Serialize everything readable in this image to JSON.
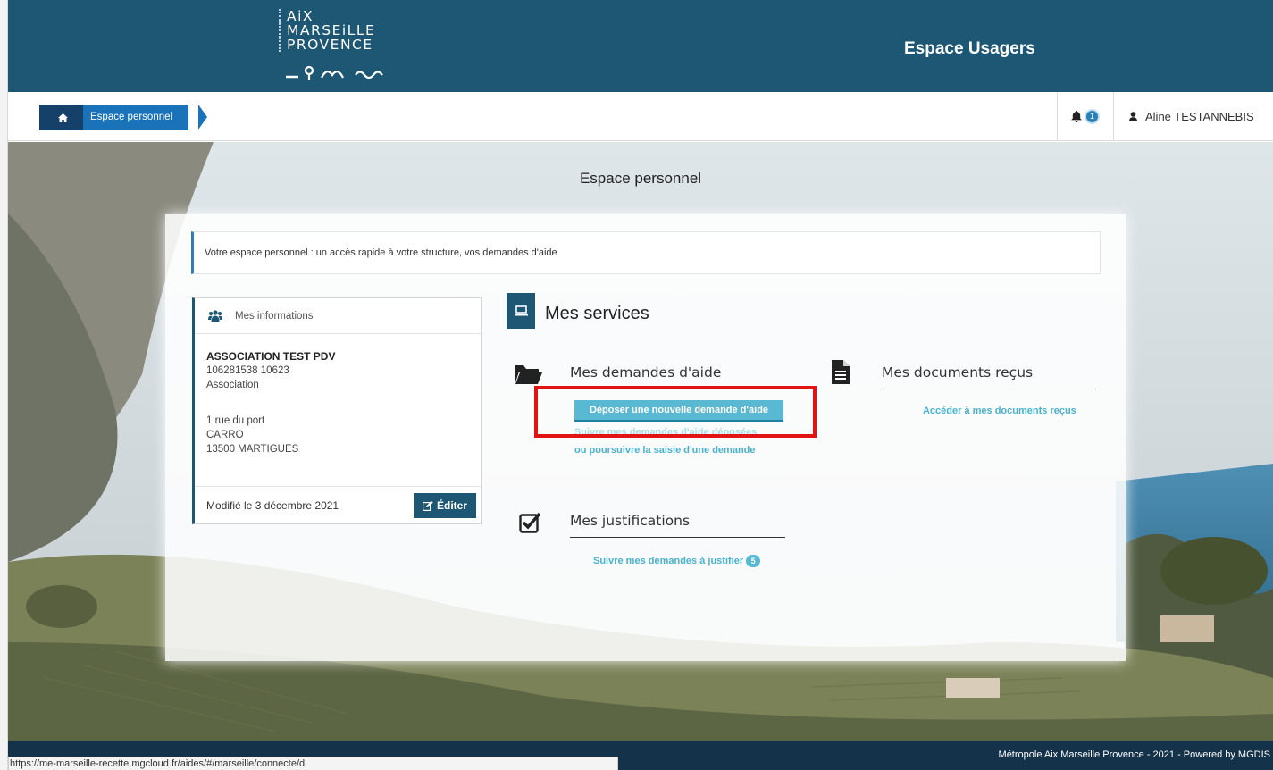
{
  "header": {
    "logo_lines": [
      "AiX",
      "MARSEiLLE",
      "PROVENCE"
    ],
    "title": "Espace Usagers"
  },
  "navbar": {
    "breadcrumb_current": "Espace personnel",
    "notification_count": "1",
    "user_name": "Aline TESTANNEBIS"
  },
  "page": {
    "title": "Espace personnel",
    "intro": "Votre espace personnel : un accès rapide à votre structure, vos demandes d'aide"
  },
  "info_card": {
    "title": "Mes informations",
    "org_name": "ASSOCIATION TEST PDV",
    "siret": "106281538 10623",
    "type": "Association",
    "address1": "1 rue du port",
    "address2": "CARRO",
    "address3": "13500 MARTIGUES",
    "modified": "Modifié le 3 décembre 2021",
    "edit_label": "Éditer"
  },
  "services": {
    "title": "Mes services",
    "demandes": {
      "title": "Mes demandes d'aide",
      "new_label": "Déposer une nouvelle demande d'aide",
      "follow_label": "Suivre mes demandes d'aide déposées",
      "continue_label": "ou poursuivre la saisie d'une demande"
    },
    "documents": {
      "title": "Mes documents reçus",
      "link_label": "Accéder à mes documents reçus"
    },
    "justifications": {
      "title": "Mes justifications",
      "link_label": "Suivre mes demandes à justifier",
      "count": "5"
    }
  },
  "footer": {
    "text": "Métropole Aix Marseille Provence - 2021 - Powered by MGDIS"
  },
  "status_bar": {
    "url": "https://me-marseille-recette.mgcloud.fr/aides/#/marseille/connecte/d"
  },
  "colors": {
    "header_bg": "#1e5774",
    "accent_link": "#4ab2cc",
    "breadcrumb": "#1a72b8",
    "highlight_box": "#e11414"
  }
}
